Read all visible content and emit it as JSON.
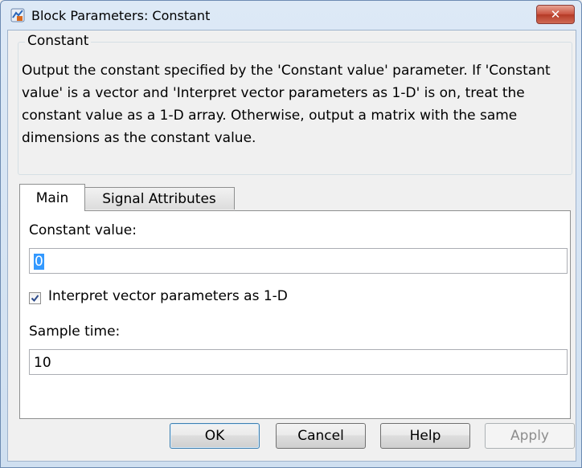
{
  "window": {
    "title": "Block Parameters: Constant",
    "close_label": "✕"
  },
  "group": {
    "legend": "Constant",
    "description": "Output the constant specified by the 'Constant value' parameter. If 'Constant value' is a vector and 'Interpret vector parameters as 1-D' is on, treat the constant value as a 1-D array. Otherwise, output a matrix with the same dimensions as the constant value."
  },
  "tabs": [
    {
      "label": "Main",
      "active": true
    },
    {
      "label": "Signal Attributes",
      "active": false
    }
  ],
  "main": {
    "constant_value_label": "Constant value:",
    "constant_value": "0",
    "interpret_checkbox_label": "Interpret vector parameters as 1-D",
    "interpret_checked": true,
    "sample_time_label": "Sample time:",
    "sample_time": "10"
  },
  "buttons": {
    "ok": "OK",
    "cancel": "Cancel",
    "help": "Help",
    "apply": "Apply"
  },
  "colors": {
    "accent": "#3399ff",
    "titlebar": "#cfdff0",
    "close": "#c9513e"
  },
  "icons": {
    "app": "simulink-block-icon",
    "close": "close-icon",
    "check": "check-icon"
  }
}
